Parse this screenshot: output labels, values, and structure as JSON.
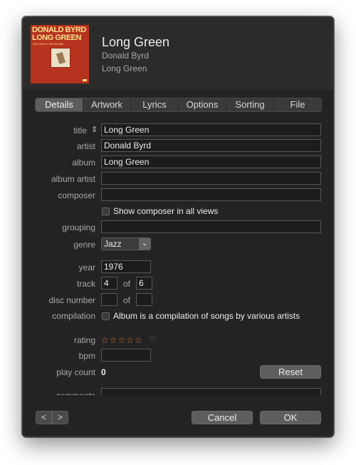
{
  "header": {
    "title": "Long Green",
    "artist": "Donald Byrd",
    "album": "Long Green",
    "artwork": {
      "line1": "DONALD BYRD",
      "line2": "LONG GREEN",
      "line3": "THE SAVOY SESSIONS"
    }
  },
  "tabs": [
    {
      "label": "Details",
      "active": true
    },
    {
      "label": "Artwork",
      "active": false
    },
    {
      "label": "Lyrics",
      "active": false
    },
    {
      "label": "Options",
      "active": false
    },
    {
      "label": "Sorting",
      "active": false
    },
    {
      "label": "File",
      "active": false
    }
  ],
  "fields": {
    "title": {
      "label": "title",
      "value": "Long Green"
    },
    "artist": {
      "label": "artist",
      "value": "Donald Byrd"
    },
    "album": {
      "label": "album",
      "value": "Long Green"
    },
    "album_artist": {
      "label": "album artist",
      "value": ""
    },
    "composer": {
      "label": "composer",
      "value": ""
    },
    "show_composer": {
      "label": "Show composer in all views",
      "checked": false
    },
    "grouping": {
      "label": "grouping",
      "value": ""
    },
    "genre": {
      "label": "genre",
      "value": "Jazz"
    },
    "year": {
      "label": "year",
      "value": "1976"
    },
    "track": {
      "label": "track",
      "number": "4",
      "of_label": "of",
      "total": "6"
    },
    "disc": {
      "label": "disc number",
      "number": "",
      "of_label": "of",
      "total": ""
    },
    "compilation": {
      "label": "compilation",
      "text": "Album is a compilation of songs by various artists",
      "checked": false
    },
    "rating": {
      "label": "rating",
      "stars": "☆☆☆☆☆",
      "value": 0,
      "max": 5,
      "heart": "♡"
    },
    "bpm": {
      "label": "bpm",
      "value": ""
    },
    "play_count": {
      "label": "play count",
      "value": "0"
    },
    "comments": {
      "label": "comments",
      "value": ""
    }
  },
  "buttons": {
    "reset": "Reset",
    "cancel": "Cancel",
    "ok": "OK",
    "prev": "<",
    "next": ">"
  },
  "colors": {
    "background": "#232323",
    "rating_star": "#d07a3f",
    "album_art": "#b5331f"
  }
}
